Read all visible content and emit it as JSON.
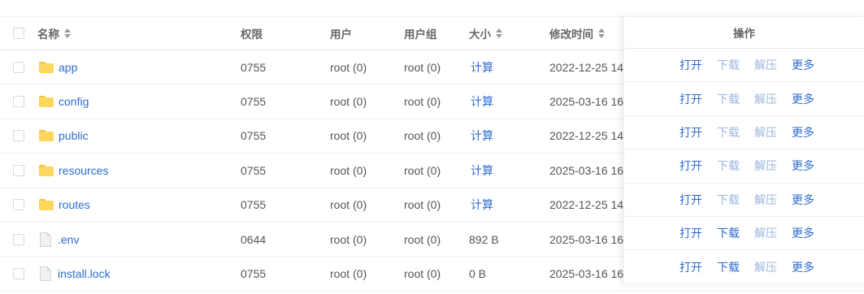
{
  "headers": {
    "name": "名称",
    "perm": "权限",
    "user": "用户",
    "group": "用户组",
    "size": "大小",
    "mtime": "修改时间",
    "ops": "操作"
  },
  "rows": [
    {
      "type": "folder",
      "name": "app",
      "perm": "0755",
      "user": "root (0)",
      "group": "root (0)",
      "size": "计算",
      "mtime": "2022-12-25 14:",
      "ops": {
        "open": "打开",
        "download": "下载",
        "extract": "解压",
        "more": "更多"
      }
    },
    {
      "type": "folder",
      "name": "config",
      "perm": "0755",
      "user": "root (0)",
      "group": "root (0)",
      "size": "计算",
      "mtime": "2025-03-16 16:",
      "ops": {
        "open": "打开",
        "download": "下载",
        "extract": "解压",
        "more": "更多"
      }
    },
    {
      "type": "folder",
      "name": "public",
      "perm": "0755",
      "user": "root (0)",
      "group": "root (0)",
      "size": "计算",
      "mtime": "2022-12-25 14:",
      "ops": {
        "open": "打开",
        "download": "下载",
        "extract": "解压",
        "more": "更多"
      }
    },
    {
      "type": "folder",
      "name": "resources",
      "perm": "0755",
      "user": "root (0)",
      "group": "root (0)",
      "size": "计算",
      "mtime": "2025-03-16 16:",
      "ops": {
        "open": "打开",
        "download": "下载",
        "extract": "解压",
        "more": "更多"
      }
    },
    {
      "type": "folder",
      "name": "routes",
      "perm": "0755",
      "user": "root (0)",
      "group": "root (0)",
      "size": "计算",
      "mtime": "2022-12-25 14:",
      "ops": {
        "open": "打开",
        "download": "下载",
        "extract": "解压",
        "more": "更多"
      }
    },
    {
      "type": "file",
      "name": ".env",
      "perm": "0644",
      "user": "root (0)",
      "group": "root (0)",
      "size": "892 B",
      "mtime": "2025-03-16 16:",
      "ops": {
        "open": "打开",
        "download": "下载",
        "extract": "解压",
        "more": "更多"
      }
    },
    {
      "type": "file",
      "name": "install.lock",
      "perm": "0755",
      "user": "root (0)",
      "group": "root (0)",
      "size": "0 B",
      "mtime": "2025-03-16 16:",
      "ops": {
        "open": "打开",
        "download": "下载",
        "extract": "解压",
        "more": "更多"
      }
    }
  ],
  "colors": {
    "link": "#2d6ccf",
    "disabled_link": "#9cb6df",
    "folder": "#fcd75b"
  }
}
